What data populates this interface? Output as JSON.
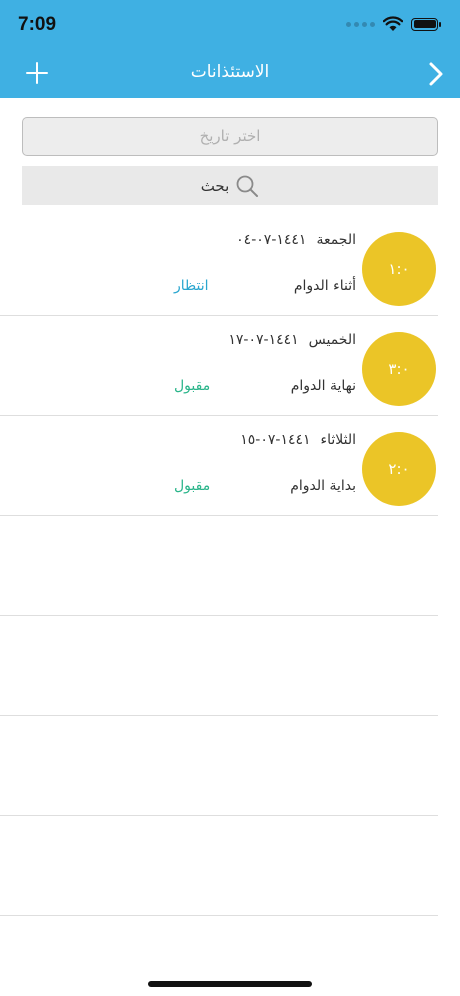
{
  "status_bar": {
    "time": "7:09"
  },
  "header": {
    "title": "الاستئذانات"
  },
  "filter": {
    "date_placeholder": "اختر تاريخ",
    "search_label": "بحث"
  },
  "colors": {
    "header": "#3fb0e3",
    "circle": "#ebc527",
    "pending": "#2aa6cf",
    "accepted": "#2ab58a"
  },
  "permissions": [
    {
      "duration": "١:٠",
      "day": "الجمعة",
      "date": "١٤٤١-٠٧-٠٤",
      "type": "أثناء الدوام",
      "status": "انتظار",
      "status_color": "#2aa6cf"
    },
    {
      "duration": "٣:٠",
      "day": "الخميس",
      "date": "١٤٤١-٠٧-١٧",
      "type": "نهاية الدوام",
      "status": "مقبول",
      "status_color": "#2ab58a"
    },
    {
      "duration": "٢:٠",
      "day": "الثلاثاء",
      "date": "١٤٤١-٠٧-١٥",
      "type": "بداية الدوام",
      "status": "مقبول",
      "status_color": "#2ab58a"
    }
  ]
}
